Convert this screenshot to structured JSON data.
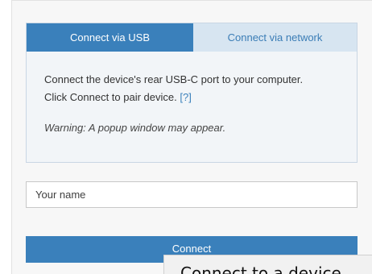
{
  "tabs": [
    {
      "label": "Connect via USB",
      "active": true
    },
    {
      "label": "Connect via network",
      "active": false
    }
  ],
  "usb_panel": {
    "line1": "Connect the device's rear USB-C port to your computer.",
    "line2": "Click Connect to pair device.",
    "help_link": "[?]",
    "warning": "Warning: A popup window may appear."
  },
  "name_field": {
    "value": "",
    "placeholder": "Your name"
  },
  "connect_button": {
    "label": "Connect"
  },
  "tooltip": {
    "text": "Connect to a device"
  },
  "colors": {
    "accent": "#3a80bb",
    "tab_inactive_bg": "#d7e5f1",
    "panel_bg": "#f2f5f8"
  }
}
